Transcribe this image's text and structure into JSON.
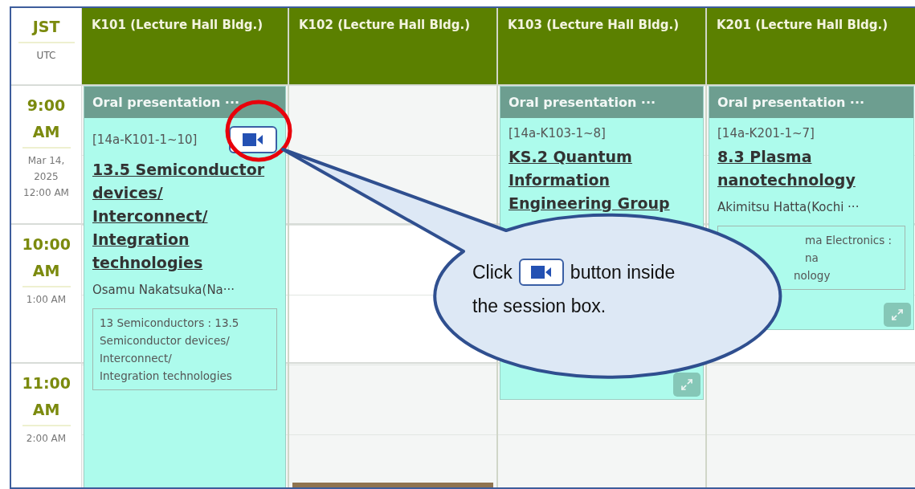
{
  "time_header": {
    "primary": "JST",
    "secondary": "UTC"
  },
  "hours": [
    {
      "jst": "9:00 AM",
      "utc": "Mar 14, 2025 12:00 AM"
    },
    {
      "jst": "10:00 AM",
      "utc": "1:00 AM"
    },
    {
      "jst": "11:00 AM",
      "utc": "2:00 AM"
    }
  ],
  "rooms": [
    {
      "name": "K101 (Lecture Hall Bldg.)",
      "session": {
        "type": "Oral presentation ···",
        "code": "[14a-K101-1~10]",
        "video_button": true,
        "title": "13.5 Semiconductor devices/ Interconnect/ Integration technologies",
        "chair": "Osamu Nakatsuka(Na···",
        "tag_lines": [
          "13 Semiconductors : 13.5",
          "Semiconductor devices/",
          "Interconnect/",
          "Integration technologies"
        ]
      }
    },
    {
      "name": "K102 (Lecture Hall Bldg.)",
      "partial_session": true
    },
    {
      "name": "K103 (Lecture Hall Bldg.)",
      "session": {
        "type": "Oral presentation ···",
        "code": "[14a-K103-1~8]",
        "title": "KS.2 Quantum Information Engineering Group",
        "expand_button": true
      }
    },
    {
      "name": "K201 (Lecture Hall Bldg.)",
      "session": {
        "type": "Oral presentation ···",
        "code": "[14a-K201-1~7]",
        "title": "8.3 Plasma nanotechnology",
        "chair": "Akimitsu Hatta(Kochi ···",
        "tag_lines": [
          "ma Electronics :",
          "na",
          "nology"
        ],
        "expand_button": true
      }
    }
  ],
  "callout": {
    "before": "Click",
    "after_lines": [
      "button inside",
      "the session box."
    ]
  }
}
